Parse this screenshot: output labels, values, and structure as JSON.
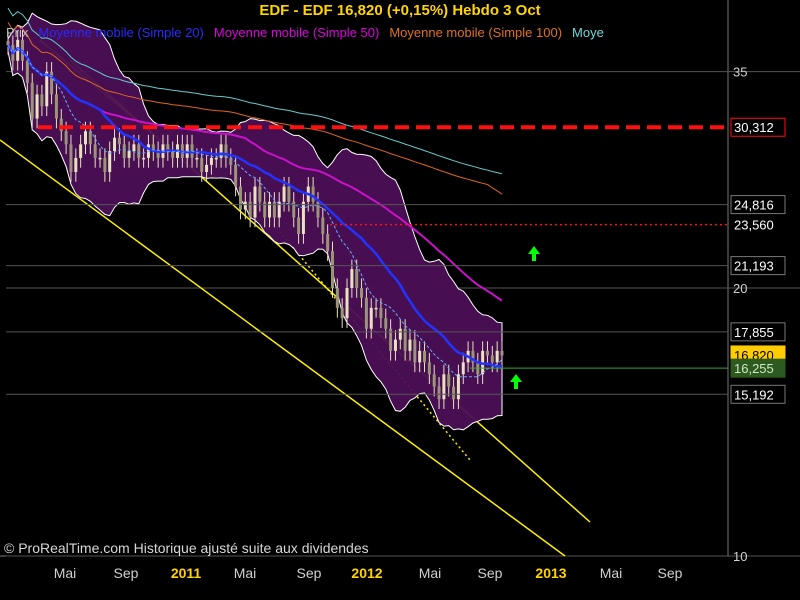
{
  "title": "EDF - EDF     16,820 (+0,15%)     Hebdo  3 Oct",
  "legend": [
    {
      "label": "Prix",
      "color": "#bdbdbd"
    },
    {
      "label": "Moyenne mobile (Simple 20)",
      "color": "#2a2aff"
    },
    {
      "label": "Moyenne mobile (Simple 50)",
      "color": "#e000e0"
    },
    {
      "label": "Moyenne mobile (Simple 100)",
      "color": "#e07020"
    },
    {
      "label": "Moye",
      "color": "#6fd8d8"
    }
  ],
  "copyright": "© ProRealTime.com Historique ajusté suite aux dividendes",
  "colors": {
    "bollinger_fill": "#4b0f55",
    "candle": "#e8e2c0",
    "sma20": "#2233ff",
    "sma50": "#cc11cc",
    "sma100": "#dd6622",
    "sma200": "#66cccc",
    "channel": "#ffee00",
    "resistance": "#ff1010",
    "price_tag": "#ffcc00",
    "support_line": "#33aa33",
    "arrow": "#00ff00"
  },
  "chart_data": {
    "type": "candlestick",
    "y_scale": "log",
    "ylim": [
      10,
      40
    ],
    "y_ticks": [
      10,
      20,
      35
    ],
    "x_ticks": [
      "Mai",
      "Sep",
      "2011",
      "Mai",
      "Sep",
      "2012",
      "Mai",
      "Sep",
      "2013",
      "Mai",
      "Sep"
    ],
    "x_tick_bold": [
      false,
      false,
      true,
      false,
      false,
      true,
      false,
      false,
      true,
      false,
      false
    ],
    "price_levels": [
      {
        "value": "30,312",
        "style": "dashed-red"
      },
      {
        "value": "24,816",
        "style": "grid"
      },
      {
        "value": "23,560",
        "style": "dotted-red"
      },
      {
        "value": "21,193",
        "style": "grid"
      },
      {
        "value": "17,855",
        "style": "grid"
      },
      {
        "value": "16,820",
        "style": "last-price"
      },
      {
        "value": "16,255",
        "style": "green-line"
      },
      {
        "value": "15,192",
        "style": "grid"
      }
    ],
    "closes": [
      37.5,
      36,
      38,
      36,
      34,
      31,
      33,
      32,
      35,
      33,
      31,
      30,
      29,
      27,
      28,
      29,
      30,
      29,
      28,
      28,
      27,
      28.5,
      29.5,
      29,
      28,
      28.5,
      29,
      28,
      28,
      29,
      28.5,
      28,
      29,
      28.5,
      28,
      29,
      28,
      29,
      28,
      28,
      27,
      27.5,
      28,
      28,
      29,
      28,
      27.5,
      26,
      24.5,
      25,
      24,
      26,
      25,
      24,
      25,
      24,
      25,
      26,
      25,
      24,
      23,
      25,
      26,
      25,
      24,
      23,
      22,
      20,
      19,
      18.5,
      20,
      21,
      20,
      19.5,
      18,
      19,
      19,
      18.5,
      18,
      17,
      17.5,
      18,
      17,
      17.5,
      16.5,
      17,
      16.5,
      16,
      15.5,
      15,
      16,
      15.5,
      15,
      16,
      16.5,
      17,
      16.5,
      16,
      17,
      16.8,
      16.5,
      17,
      16.8
    ]
  }
}
